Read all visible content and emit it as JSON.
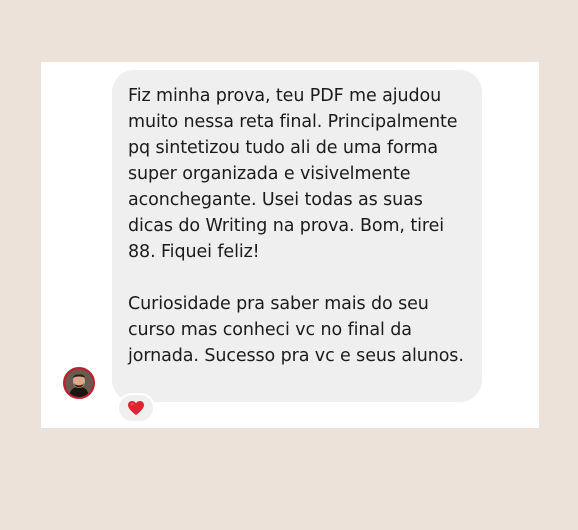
{
  "message": {
    "paragraph_1": "Fiz minha prova, teu PDF me ajudou muito nessa reta final. Principalmente pq sintetizou tudo ali de uma forma super organizada e visivelmente aconchegante. Usei todas as suas dicas do Writing na prova. Bom, tirei 88. Fiquei feliz!",
    "paragraph_2": "Curiosidade pra saber mais do seu curso mas conheci vc no final da jornada. Sucesso pra vc e seus alunos.",
    "reaction": "heart-icon"
  },
  "colors": {
    "page_background": "#ece2d9",
    "card_background": "#ffffff",
    "bubble_background": "#efefef",
    "text": "#1b1b1b",
    "heart": "#e0242f",
    "avatar_ring": "#c81d2c"
  }
}
